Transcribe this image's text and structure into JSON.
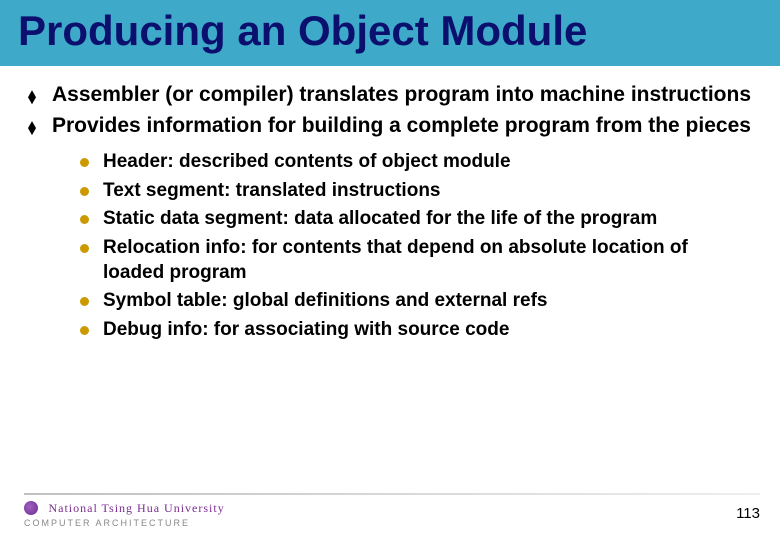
{
  "title": "Producing an Object Module",
  "bullets": [
    "Assembler (or compiler) translates program into machine instructions",
    "Provides information for building a complete program from the pieces"
  ],
  "subbullets": [
    "Header: described contents of object module",
    "Text segment: translated instructions",
    "Static data segment: data allocated for the life of the program",
    "Relocation info: for contents that depend on absolute location of loaded program",
    "Symbol table: global definitions and external refs",
    "Debug info: for associating with source code"
  ],
  "footer": {
    "university": "National Tsing Hua University",
    "course": "COMPUTER ARCHITECTURE",
    "page": "113"
  }
}
